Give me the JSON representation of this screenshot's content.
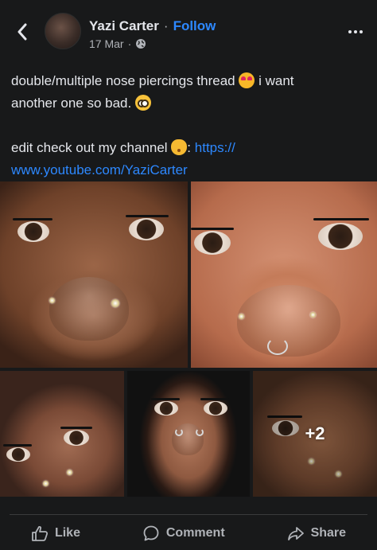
{
  "header": {
    "author_name": "Yazi Carter",
    "follow_label": "Follow",
    "separator": "·",
    "date": "17 Mar",
    "meta_separator": "·",
    "privacy_icon": "globe-icon",
    "back_icon": "chevron-left-icon",
    "more_icon": "more-horizontal-icon"
  },
  "post": {
    "line1_text": "double/multiple nose piercings thread",
    "line1_emoji": "heart-eyes-emoji",
    "line1_tail": " i want",
    "line2_text": "another one so bad.",
    "line2_emoji": "pleading-face-emoji",
    "line3_text": "edit check out my channel",
    "line3_emoji": "kissing-cat-emoji",
    "line3_colon": ":",
    "link_part1": "https://",
    "link_part2": "www.youtube.com/YaziCarter"
  },
  "photos": {
    "count": 5,
    "more_count_label": "+2"
  },
  "actions": {
    "like_label": "Like",
    "comment_label": "Comment",
    "share_label": "Share"
  },
  "colors": {
    "background": "#18191a",
    "text": "#e4e6eb",
    "secondary_text": "#b0b3b8",
    "link": "#2d88ff"
  }
}
